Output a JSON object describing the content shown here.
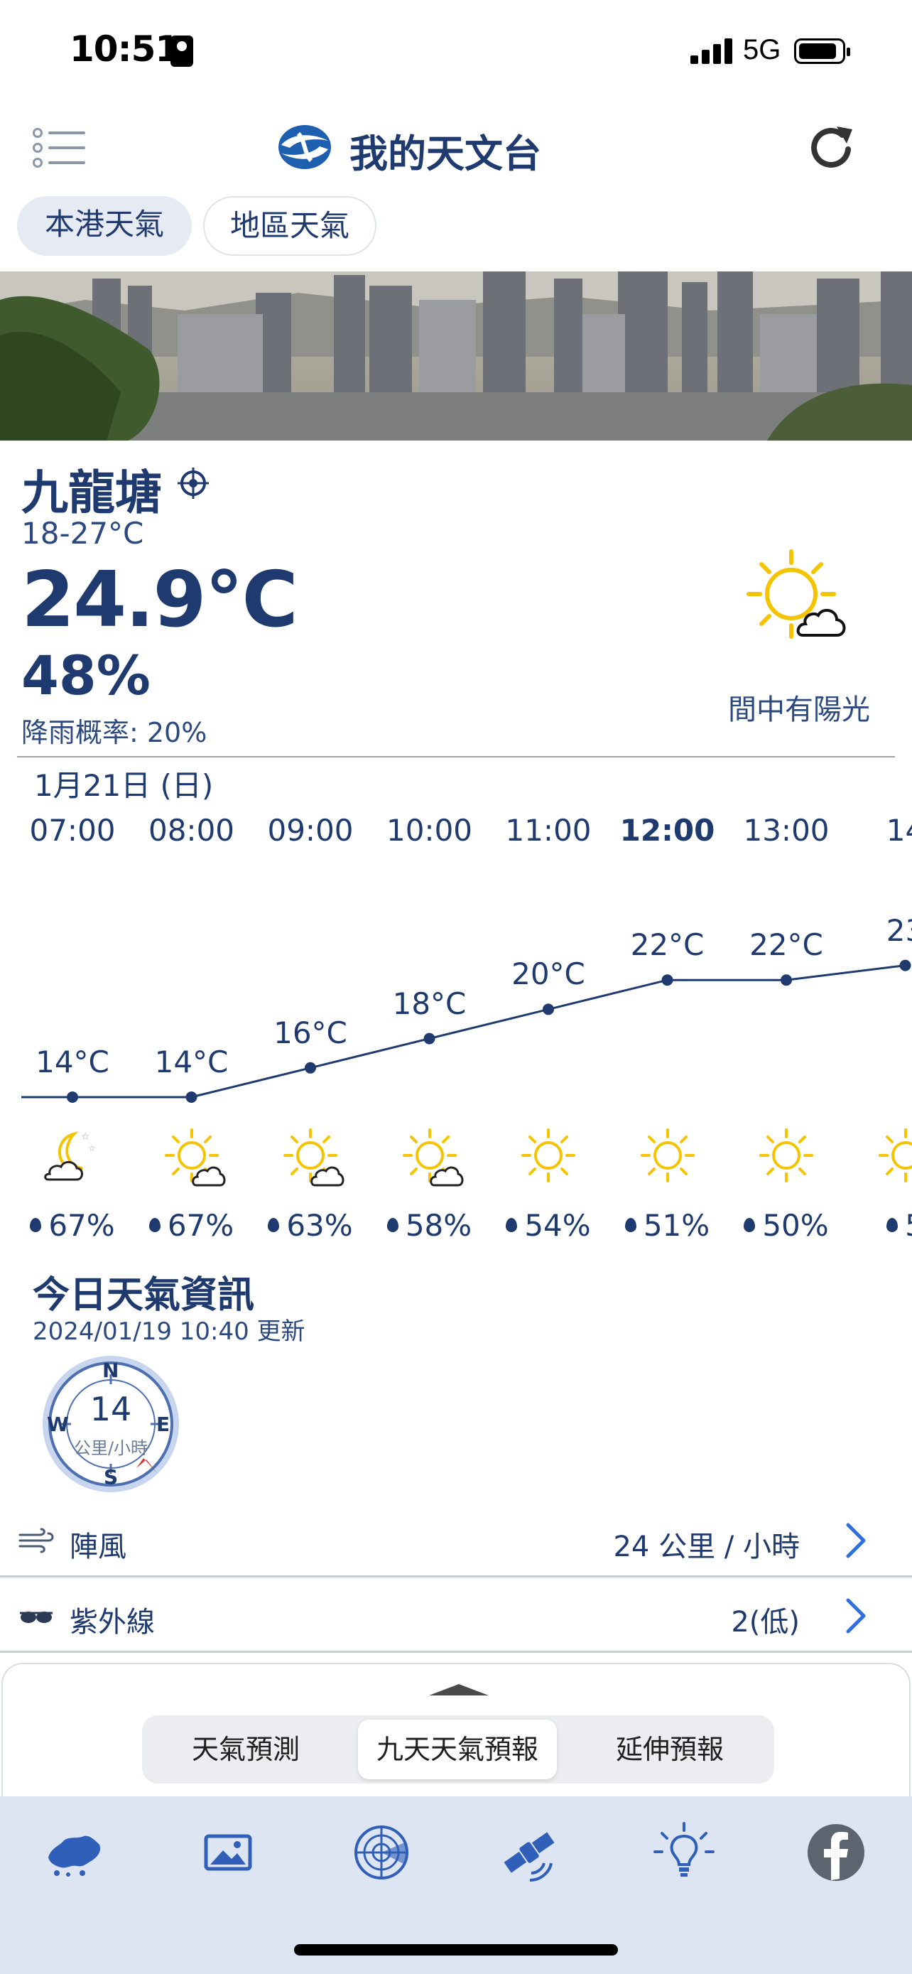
{
  "status_bar": {
    "time": "10:51",
    "network": "5G"
  },
  "header": {
    "title": "我的天文台",
    "menu_icon": "menu-icon",
    "refresh_icon": "refresh-icon"
  },
  "segment_tabs": [
    {
      "label": "本港天氣",
      "active": true
    },
    {
      "label": "地區天氣",
      "active": false
    }
  ],
  "current": {
    "location": "九龍塘",
    "temp_range": "18-27°C",
    "temperature": "24.9°C",
    "humidity": "48%",
    "rain_probability": "降雨概率: 20%",
    "condition": "間中有陽光",
    "condition_icon": "sun-with-cloud-icon"
  },
  "hourly": {
    "date": "1月21日 (日)",
    "items": [
      {
        "time": "07:00",
        "temp": "14°C",
        "temp_value": 14,
        "humidity": "67%",
        "icon": "moon-cloud-icon",
        "bold": false
      },
      {
        "time": "08:00",
        "temp": "14°C",
        "temp_value": 14,
        "humidity": "67%",
        "icon": "sun-cloud-icon",
        "bold": false
      },
      {
        "time": "09:00",
        "temp": "16°C",
        "temp_value": 16,
        "humidity": "63%",
        "icon": "sun-cloud-icon",
        "bold": false
      },
      {
        "time": "10:00",
        "temp": "18°C",
        "temp_value": 18,
        "humidity": "58%",
        "icon": "sun-cloud-icon",
        "bold": false
      },
      {
        "time": "11:00",
        "temp": "20°C",
        "temp_value": 20,
        "humidity": "54%",
        "icon": "sun-icon",
        "bold": false
      },
      {
        "time": "12:00",
        "temp": "22°C",
        "temp_value": 22,
        "humidity": "51%",
        "icon": "sun-icon",
        "bold": true
      },
      {
        "time": "13:00",
        "temp": "22°C",
        "temp_value": 22,
        "humidity": "50%",
        "icon": "sun-icon",
        "bold": false
      },
      {
        "time": "14",
        "temp": "23",
        "temp_value": 23,
        "humidity": "5",
        "icon": "sun-icon",
        "bold": false
      }
    ]
  },
  "info": {
    "title": "今日天氣資訊",
    "updated": "2024/01/19 10:40 更新",
    "wind_speed": "14",
    "wind_unit": "公里/小時",
    "compass": {
      "n": "N",
      "e": "E",
      "s": "S",
      "w": "W"
    },
    "rows": [
      {
        "label": "陣風",
        "value": "24 公里 / 小時",
        "icon": "wind-icon"
      },
      {
        "label": "紫外線",
        "value": "2(低)",
        "icon": "sunglasses-icon"
      }
    ]
  },
  "bottom_sheet": {
    "tabs": [
      {
        "label": "天氣預測",
        "active": false
      },
      {
        "label": "九天天氣預報",
        "active": true
      },
      {
        "label": "延伸預報",
        "active": false
      }
    ]
  },
  "tab_bar": [
    "hong-kong-map-icon",
    "photo-icon",
    "radar-icon",
    "satellite-icon",
    "warning-bulb-icon",
    "facebook-icon"
  ],
  "colors": {
    "primary": "#1f3a6e",
    "tab_bar_bg": "#dde4f2",
    "sun": "#f5c400",
    "accent_arrow": "#e03030",
    "chevron": "#2f6fe0"
  }
}
